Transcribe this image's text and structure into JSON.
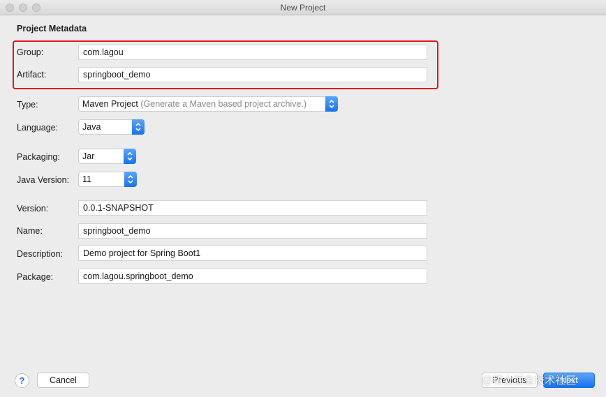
{
  "window": {
    "title": "New Project"
  },
  "section": {
    "title": "Project Metadata"
  },
  "fields": {
    "group": {
      "label": "Group:",
      "value": "com.lagou"
    },
    "artifact": {
      "label": "Artifact:",
      "value": "springboot_demo"
    },
    "type": {
      "label": "Type:",
      "value": "Maven Project",
      "hint": "(Generate a Maven based project archive.)"
    },
    "language": {
      "label": "Language:",
      "value": "Java"
    },
    "packaging": {
      "label": "Packaging:",
      "value": "Jar"
    },
    "java_version": {
      "label": "Java Version:",
      "value": "11"
    },
    "version": {
      "label": "Version:",
      "value": "0.0.1-SNAPSHOT"
    },
    "name": {
      "label": "Name:",
      "value": "springboot_demo"
    },
    "description": {
      "label": "Description:",
      "value": "Demo project for Spring Boot1"
    },
    "package": {
      "label": "Package:",
      "value": "com.lagou.springboot_demo"
    }
  },
  "footer": {
    "help": "?",
    "cancel": "Cancel",
    "previous": "Previous",
    "next": "Next",
    "watermark": "@稀土掘金技术社区"
  },
  "colors": {
    "highlight": "#e3141d",
    "accent": "#1871ef"
  }
}
